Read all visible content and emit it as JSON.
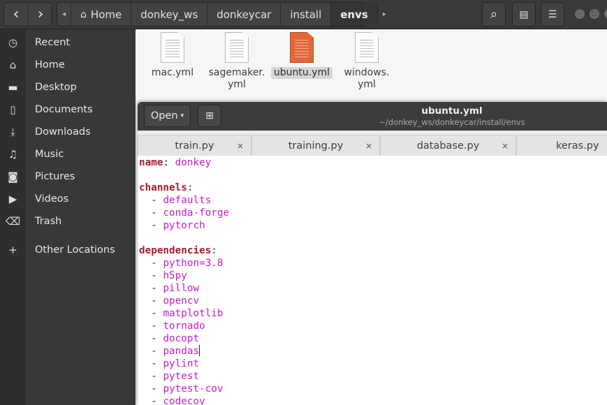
{
  "header": {
    "back_icon": "‹",
    "forward_icon": "›",
    "breadcrumb_left_arrow": "◂",
    "breadcrumb_right_arrow": "▸",
    "home_label": "Home",
    "breadcrumbs": [
      "donkey_ws",
      "donkeycar",
      "install",
      "envs"
    ],
    "search_icon": "⌕",
    "view_icon": "▤",
    "menu_icon": "☰"
  },
  "sidebar": {
    "items": [
      {
        "label": "Recent",
        "icon": "◷"
      },
      {
        "label": "Home",
        "icon": "⌂"
      },
      {
        "label": "Desktop",
        "icon": "▬"
      },
      {
        "label": "Documents",
        "icon": "▯"
      },
      {
        "label": "Downloads",
        "icon": "⤓"
      },
      {
        "label": "Music",
        "icon": "♫"
      },
      {
        "label": "Pictures",
        "icon": "◙"
      },
      {
        "label": "Videos",
        "icon": "▶"
      },
      {
        "label": "Trash",
        "icon": "⌫"
      },
      {
        "label": "Other Locations",
        "icon": "+"
      }
    ]
  },
  "files": [
    {
      "line1": "mac.yml",
      "line2": ""
    },
    {
      "line1": "sagemaker.",
      "line2": "yml"
    },
    {
      "line1": "ubuntu.yml",
      "line2": "",
      "selected": true
    },
    {
      "line1": "windows.",
      "line2": "yml"
    }
  ],
  "editor": {
    "open_label": "Open",
    "open_caret": "▾",
    "pin_icon": "⊞",
    "title": "ubuntu.yml",
    "subtitle": "~/donkey_ws/donkeycar/install/envs",
    "tab_close": "×",
    "tabs": [
      "train.py",
      "training.py",
      "database.py",
      "keras.py"
    ]
  },
  "code": {
    "name_key": "name",
    "name_value": "donkey",
    "channels_key": "channels",
    "channels": [
      "defaults",
      "conda-forge",
      "pytorch"
    ],
    "dependencies_key": "dependencies",
    "dependencies": [
      "python=3.8",
      "h5py",
      "pillow",
      "opencv",
      "matplotlib",
      "tornado",
      "docopt",
      "pandas",
      "pylint",
      "pytest",
      "pytest-cov",
      "codecov"
    ],
    "colon": ":",
    "dash": "-"
  }
}
